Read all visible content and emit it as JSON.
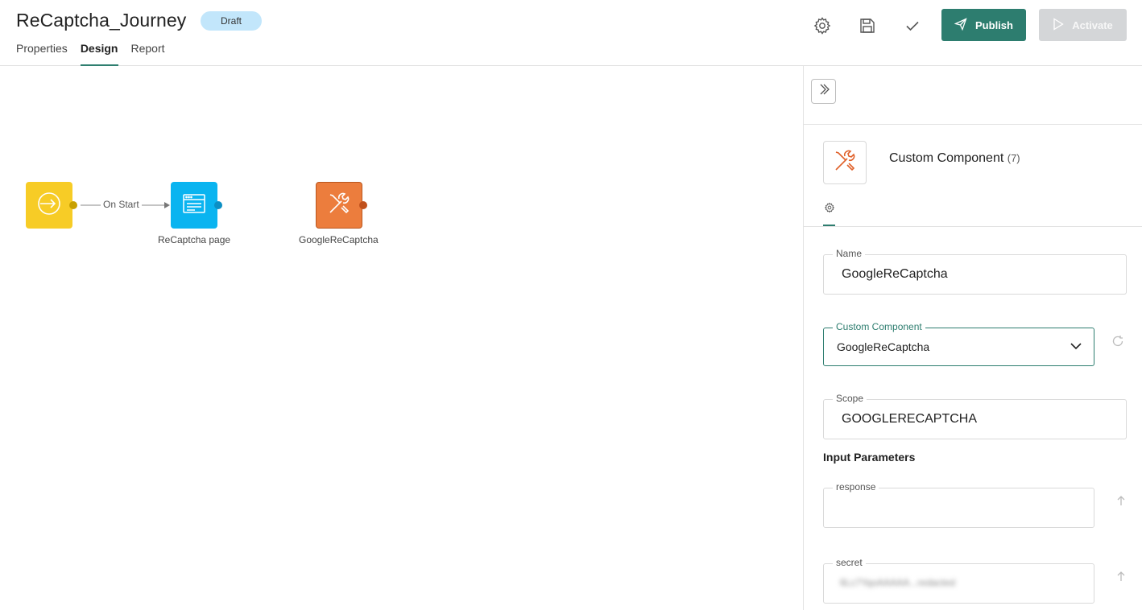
{
  "header": {
    "title": "ReCaptcha_Journey",
    "status_badge": "Draft",
    "tabs": [
      {
        "label": "Properties",
        "active": false
      },
      {
        "label": "Design",
        "active": true
      },
      {
        "label": "Report",
        "active": false
      }
    ],
    "icons": [
      "gear-icon",
      "save-icon",
      "checkmark-icon"
    ],
    "publish_label": "Publish",
    "activate_label": "Activate"
  },
  "canvas": {
    "edge_label": "On Start",
    "nodes": [
      {
        "name": "start",
        "label": "",
        "color": "#f7cc26"
      },
      {
        "name": "recaptcha-page",
        "label": "ReCaptcha page",
        "color": "#0ab4f0"
      },
      {
        "name": "googlerecaptcha",
        "label": "GoogleReCaptcha",
        "color": "#ec7d3d"
      }
    ]
  },
  "panel": {
    "component_title": "Custom Component",
    "component_count": "(7)",
    "name_field": {
      "label": "Name",
      "value": "GoogleReCaptcha"
    },
    "custom_component_field": {
      "label": "Custom Component",
      "value": "GoogleReCaptcha"
    },
    "scope_field": {
      "label": "Scope",
      "value": "GOOGLERECAPTCHA"
    },
    "input_parameters_title": "Input Parameters",
    "params": [
      {
        "label": "response",
        "value": ""
      },
      {
        "label": "secret",
        "value": "6Lc7YqoAAAAA...redacted"
      }
    ]
  },
  "colors": {
    "accent": "#2d7d6f",
    "badge": "#c2e6fb",
    "start_node": "#f7cc26",
    "page_node": "#0ab4f0",
    "component_node": "#ec7d3d"
  }
}
